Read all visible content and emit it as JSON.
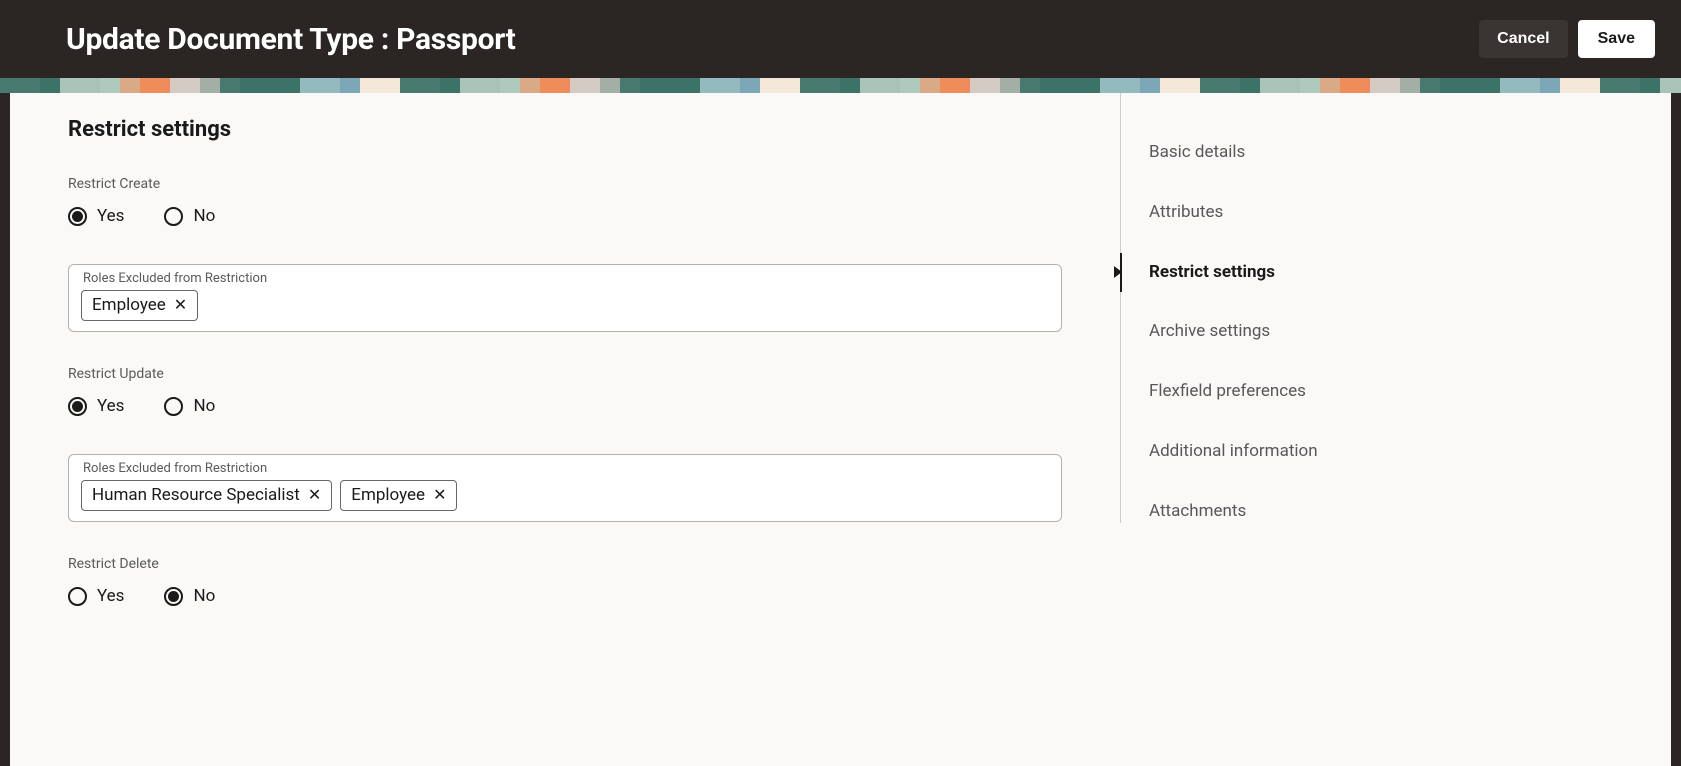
{
  "header": {
    "title": "Update Document Type : Passport",
    "cancel_label": "Cancel",
    "save_label": "Save"
  },
  "main": {
    "section_title": "Restrict settings",
    "restrict_create": {
      "label": "Restrict Create",
      "options": {
        "yes": "Yes",
        "no": "No"
      },
      "selected": "yes",
      "roles_label": "Roles Excluded from Restriction",
      "roles": [
        "Employee"
      ]
    },
    "restrict_update": {
      "label": "Restrict Update",
      "options": {
        "yes": "Yes",
        "no": "No"
      },
      "selected": "yes",
      "roles_label": "Roles Excluded from Restriction",
      "roles": [
        "Human Resource Specialist",
        "Employee"
      ]
    },
    "restrict_delete": {
      "label": "Restrict Delete",
      "options": {
        "yes": "Yes",
        "no": "No"
      },
      "selected": "no"
    }
  },
  "nav": {
    "items": [
      {
        "label": "Basic details",
        "active": false
      },
      {
        "label": "Attributes",
        "active": false
      },
      {
        "label": "Restrict settings",
        "active": true
      },
      {
        "label": "Archive settings",
        "active": false
      },
      {
        "label": "Flexfield preferences",
        "active": false
      },
      {
        "label": "Additional information",
        "active": false
      },
      {
        "label": "Attachments",
        "active": false
      }
    ]
  }
}
